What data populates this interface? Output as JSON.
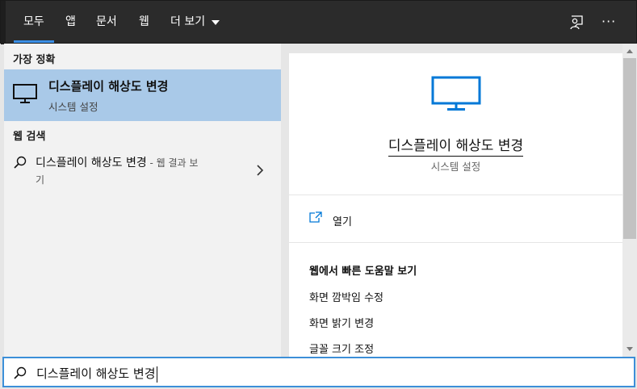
{
  "tabs": [
    {
      "label": "모두",
      "active": true
    },
    {
      "label": "앱"
    },
    {
      "label": "문서"
    },
    {
      "label": "웹"
    },
    {
      "label": "더 보기"
    }
  ],
  "topbar_icons": [
    "feedback-icon",
    "more-icon"
  ],
  "more_glyph": "···",
  "left": {
    "best_match_label": "가장 정확",
    "best_match": {
      "title": "디스플레이 해상도 변경",
      "subtitle": "시스템 설정",
      "icon": "monitor-icon"
    },
    "web_search_label": "웹 검색",
    "web_result": {
      "title": "디스플레이 해상도 변경",
      "suffix_line1": " - 웹 결과 보",
      "suffix_line2": "기",
      "icon": "search-icon",
      "chevron": "chevron-right-icon"
    }
  },
  "right": {
    "hero_title": "디스플레이 해상도 변경",
    "hero_subtitle": "시스템 설정",
    "open_label": "열기",
    "quick_help_heading": "웹에서 빠른 도움말 보기",
    "quick_help_items": [
      "화면 깜박임 수정",
      "화면 밝기 변경",
      "글꼴 크기 조정"
    ]
  },
  "search": {
    "value": "디스플레이 해상도 변경",
    "icon": "search-icon"
  },
  "colors": {
    "accent": "#3a8ee6",
    "selected": "#a9c9e8",
    "topbar": "#2b2b2b",
    "icon_blue": "#0078d7"
  }
}
